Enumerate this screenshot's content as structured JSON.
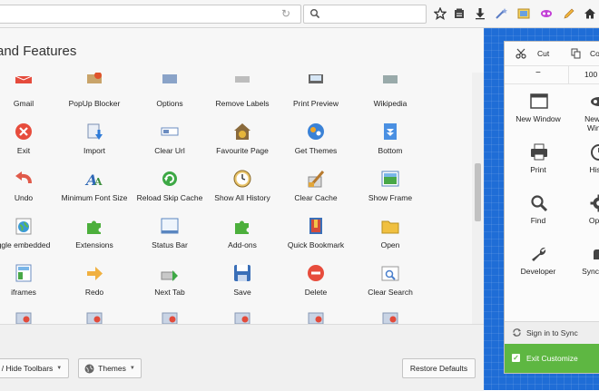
{
  "toolbar": {
    "icons": [
      "reload-icon",
      "search-icon",
      "bookmark-star-icon",
      "reading-list-icon",
      "download-icon",
      "wand-icon",
      "picture-icon",
      "mask-icon",
      "pencil-icon",
      "home-icon"
    ]
  },
  "panel": {
    "title": "and Features"
  },
  "palette": {
    "items": [
      {
        "label": "Gmail",
        "icon": "gmail-icon"
      },
      {
        "label": "PopUp Blocker",
        "icon": "popup-blocker-icon"
      },
      {
        "label": "Options",
        "icon": "options-icon"
      },
      {
        "label": "Remove Labels",
        "icon": "remove-labels-icon"
      },
      {
        "label": "Print Preview",
        "icon": "print-preview-icon"
      },
      {
        "label": "Wikipedia",
        "icon": "wikipedia-icon"
      },
      {
        "label": "Exit",
        "icon": "exit-icon"
      },
      {
        "label": "Import",
        "icon": "import-icon"
      },
      {
        "label": "Clear Url",
        "icon": "clear-url-icon"
      },
      {
        "label": "Favourite Page",
        "icon": "favourite-page-icon"
      },
      {
        "label": "Get Themes",
        "icon": "get-themes-icon"
      },
      {
        "label": "Bottom",
        "icon": "bottom-icon"
      },
      {
        "label": "Undo",
        "icon": "undo-icon"
      },
      {
        "label": "Minimum Font Size",
        "icon": "font-size-icon"
      },
      {
        "label": "Reload Skip Cache",
        "icon": "reload-skip-cache-icon"
      },
      {
        "label": "Show All History",
        "icon": "history-clock-icon"
      },
      {
        "label": "Clear Cache",
        "icon": "clear-cache-icon"
      },
      {
        "label": "Show Frame",
        "icon": "show-frame-icon"
      },
      {
        "label": "ggle embedded",
        "icon": "globe-icon"
      },
      {
        "label": "Extensions",
        "icon": "puzzle-icon"
      },
      {
        "label": "Status Bar",
        "icon": "status-bar-icon"
      },
      {
        "label": "Add-ons",
        "icon": "puzzle-icon"
      },
      {
        "label": "Quick Bookmark",
        "icon": "quick-bookmark-icon"
      },
      {
        "label": "Open",
        "icon": "folder-icon"
      },
      {
        "label": "iframes",
        "icon": "iframes-icon"
      },
      {
        "label": "Redo",
        "icon": "redo-icon"
      },
      {
        "label": "Next Tab",
        "icon": "next-tab-icon"
      },
      {
        "label": "Save",
        "icon": "save-icon"
      },
      {
        "label": "Delete",
        "icon": "delete-icon"
      },
      {
        "label": "Clear Search",
        "icon": "clear-search-icon"
      },
      {
        "label": "",
        "icon": "partial-icon"
      },
      {
        "label": "",
        "icon": "partial-icon"
      },
      {
        "label": "",
        "icon": "partial-icon"
      },
      {
        "label": "",
        "icon": "partial-icon"
      },
      {
        "label": "",
        "icon": "partial-icon"
      },
      {
        "label": "",
        "icon": "partial-icon"
      }
    ]
  },
  "bottom": {
    "toolbars_label": "/ Hide Toolbars",
    "themes_label": "Themes",
    "restore_label": "Restore Defaults"
  },
  "menu": {
    "cut_label": "Cut",
    "copy_label": "Co",
    "zoom_minus": "−",
    "zoom_value": "100",
    "buttons": [
      {
        "label": "New Window",
        "icon": "new-window-icon"
      },
      {
        "label": "New Pri\nWindo",
        "icon": "private-mask-icon"
      },
      {
        "label": "Print",
        "icon": "printer-icon"
      },
      {
        "label": "Histo",
        "icon": "history-icon"
      },
      {
        "label": "Find",
        "icon": "magnifier-icon"
      },
      {
        "label": "Optio",
        "icon": "gear-icon"
      },
      {
        "label": "Developer",
        "icon": "wrench-icon"
      },
      {
        "label": "Synced T",
        "icon": "synced-tabs-icon"
      }
    ],
    "sync_label": "Sign in to Sync",
    "exit_label": "Exit Customize"
  },
  "colors": {
    "accent_blue": "#1f6dd6",
    "exit_green": "#5eb742"
  }
}
